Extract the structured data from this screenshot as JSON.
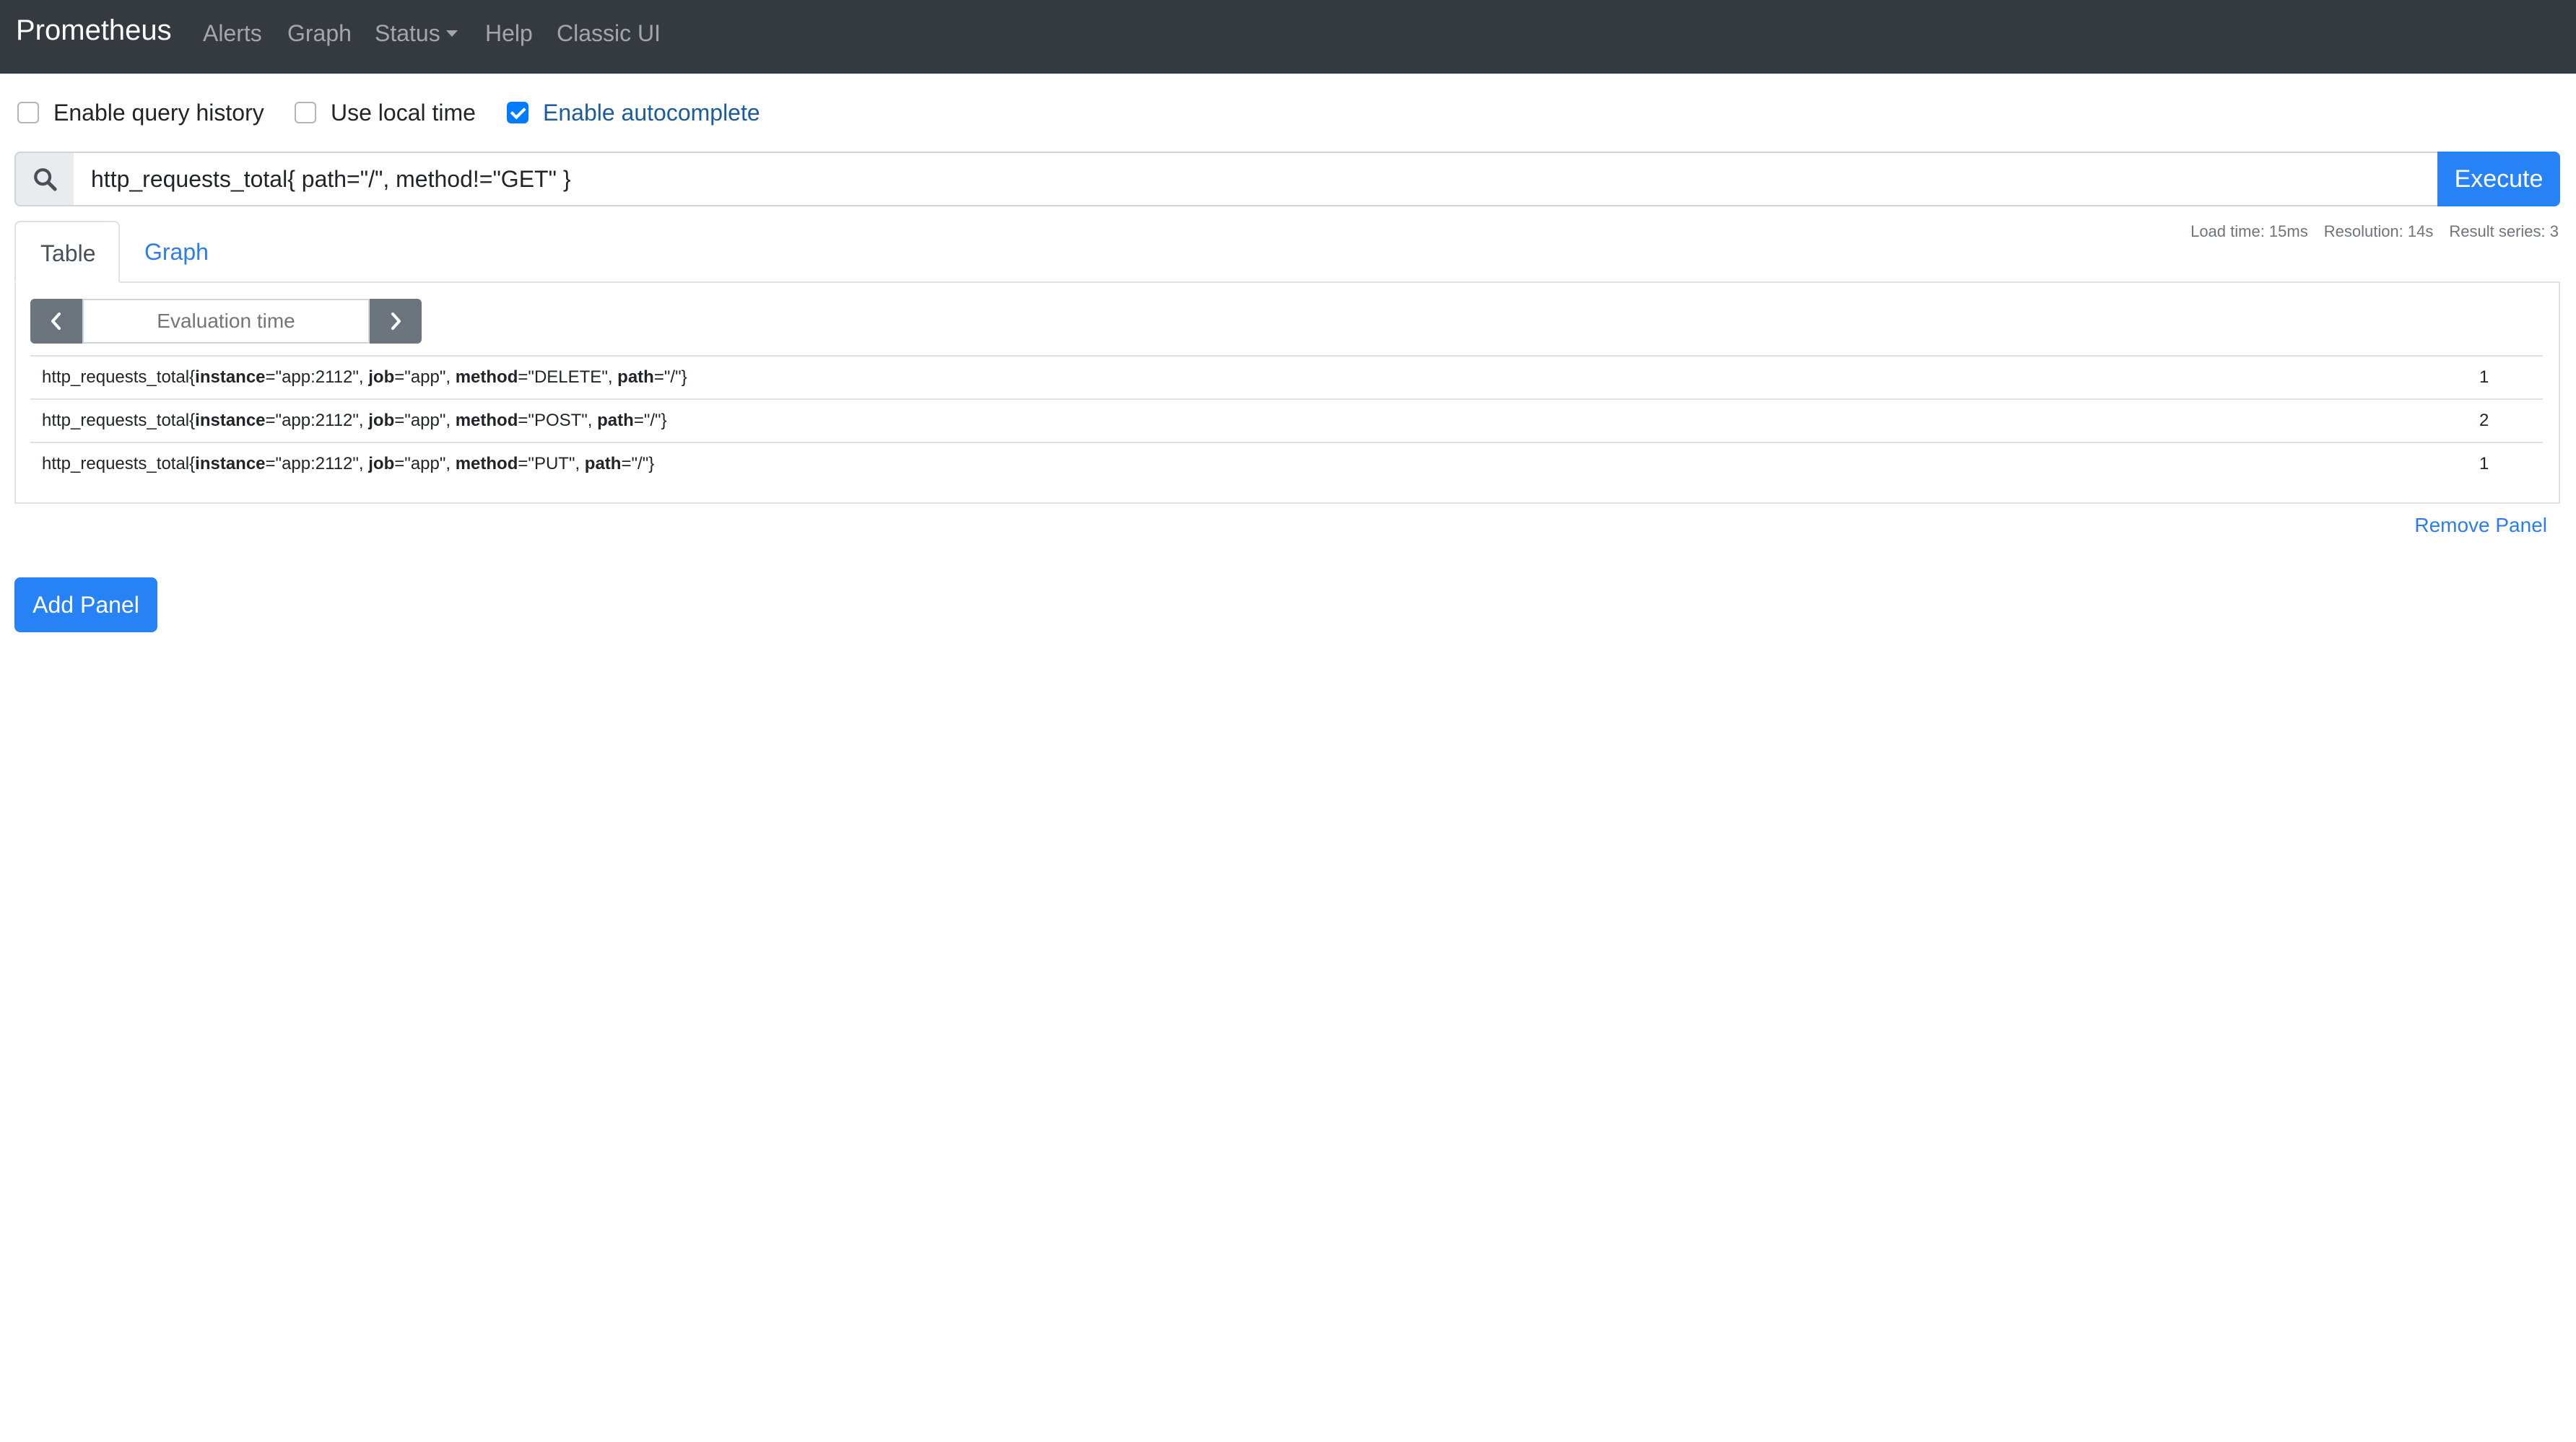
{
  "navbar": {
    "brand": "Prometheus",
    "links": {
      "alerts": "Alerts",
      "graph": "Graph",
      "status": "Status",
      "help": "Help",
      "classic_ui": "Classic UI"
    }
  },
  "options": {
    "query_history": {
      "label": "Enable query history",
      "checked": false
    },
    "local_time": {
      "label": "Use local time",
      "checked": false
    },
    "autocomplete": {
      "label": "Enable autocomplete",
      "checked": true
    }
  },
  "query": {
    "value": "http_requests_total{ path=\"/\", method!=\"GET\" }",
    "execute_label": "Execute"
  },
  "tabs": {
    "table": "Table",
    "graph": "Graph",
    "active": "table"
  },
  "stats": {
    "load_time": "Load time: 15ms",
    "resolution": "Resolution: 14s",
    "result_series": "Result series: 3"
  },
  "panel": {
    "evaluation_placeholder": "Evaluation time",
    "metric": "http_requests_total",
    "results": [
      {
        "instance": "app:2112",
        "job": "app",
        "method": "DELETE",
        "path": "/",
        "value": "1"
      },
      {
        "instance": "app:2112",
        "job": "app",
        "method": "POST",
        "path": "/",
        "value": "2"
      },
      {
        "instance": "app:2112",
        "job": "app",
        "method": "PUT",
        "path": "/",
        "value": "1"
      }
    ],
    "remove_label": "Remove Panel"
  },
  "add_panel_label": "Add Panel",
  "colors": {
    "navbar": "#343a40",
    "primary": "#2783f5",
    "link": "#2b7de9",
    "secondary": "#6c757d"
  },
  "icons": {
    "search": "search-icon",
    "prev": "chevron-left-icon",
    "next": "chevron-right-icon",
    "status_caret": "caret-down-icon"
  }
}
